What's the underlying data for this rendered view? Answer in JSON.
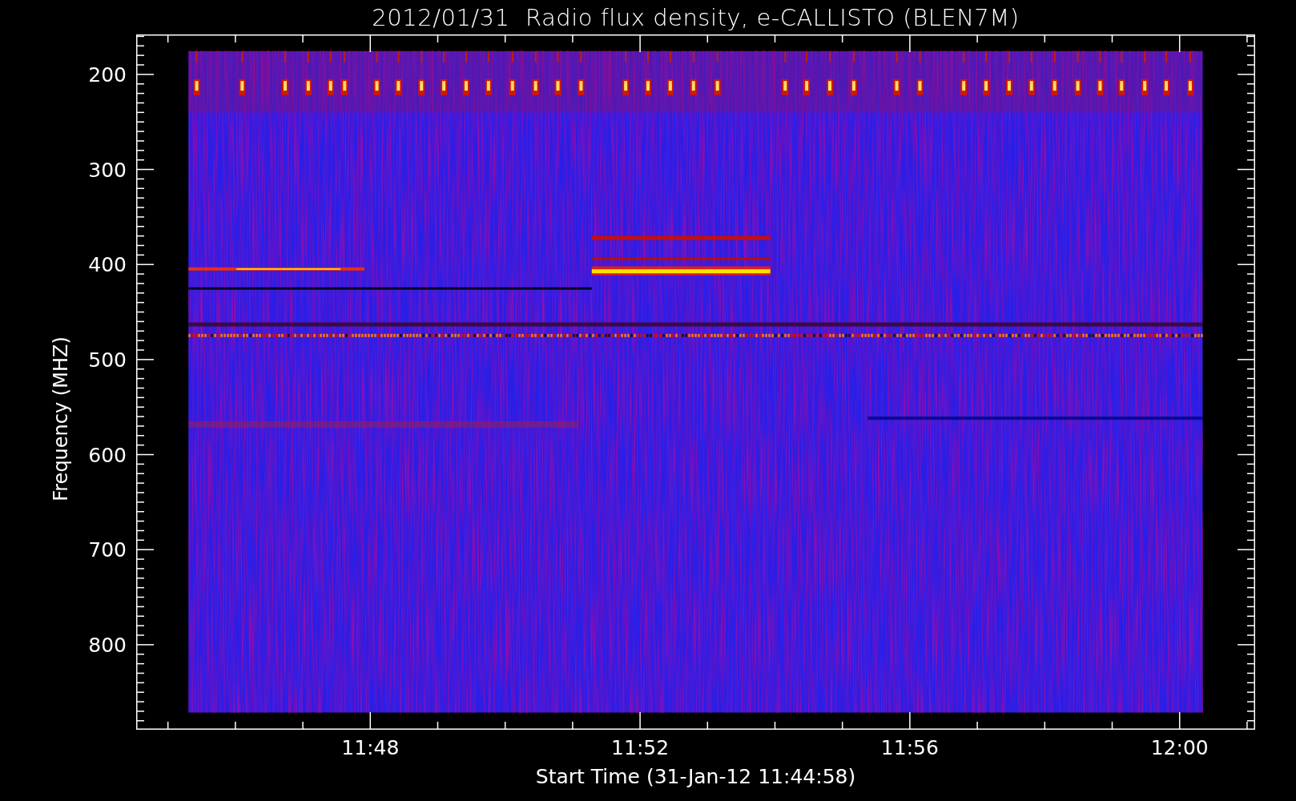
{
  "title": "2012/01/31  Radio flux density, e-CALLISTO (BLEN7M)",
  "y_axis": {
    "label": "Frequency (MHZ)",
    "ticks": [
      "200",
      "300",
      "400",
      "500",
      "600",
      "700",
      "800"
    ]
  },
  "x_axis": {
    "label": "Start Time (31-Jan-12 11:44:58)",
    "ticks": [
      "11:48",
      "11:52",
      "11:56",
      "12:00"
    ]
  }
}
